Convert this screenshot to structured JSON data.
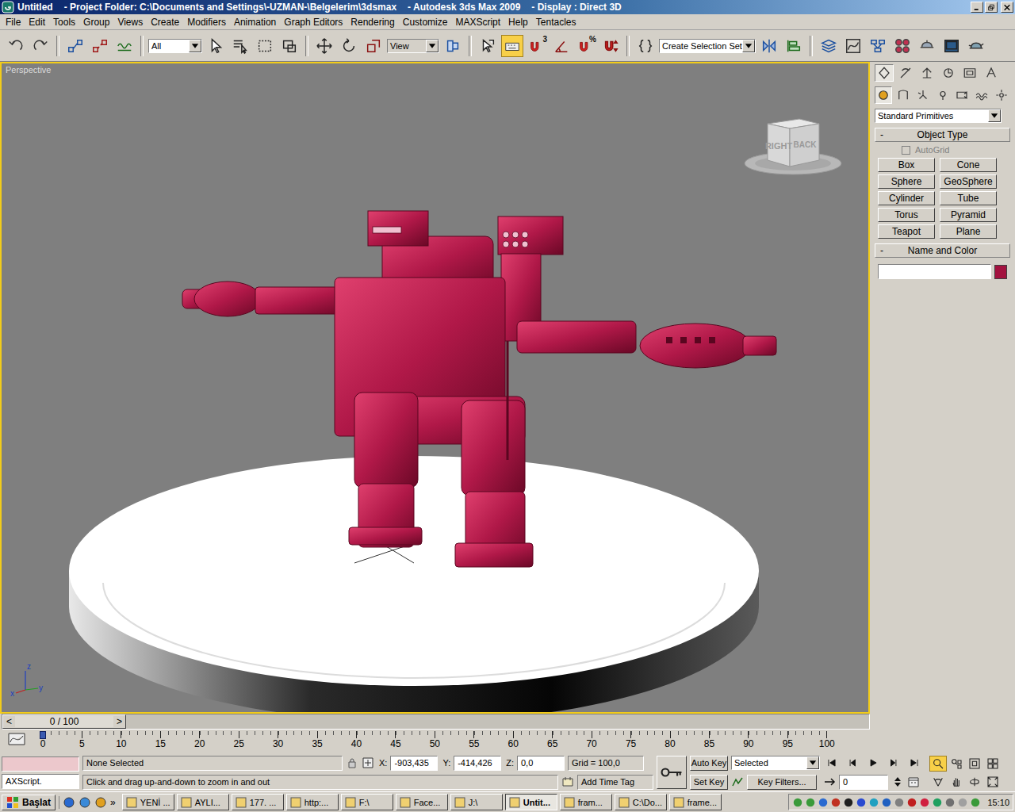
{
  "window": {
    "title": "Untitled",
    "project": "- Project Folder: C:\\Documents and Settings\\-UZMAN-\\Belgelerim\\3dsmax",
    "app": "- Autodesk 3ds Max  2009",
    "display": "- Display : Direct 3D"
  },
  "menu": [
    "File",
    "Edit",
    "Tools",
    "Group",
    "Views",
    "Create",
    "Modifiers",
    "Animation",
    "Graph Editors",
    "Rendering",
    "Customize",
    "MAXScript",
    "Help",
    "Tentacles"
  ],
  "toolbar": {
    "selection_filter": "All",
    "reference_coord": "View",
    "selection_set": "Create Selection Set",
    "snap_mode": "3",
    "percent_glyph": "%",
    "shortcut_override_on": true
  },
  "viewport": {
    "label": "Perspective",
    "viewcube": {
      "front": "RIGHT",
      "side": "BACK"
    },
    "axes": {
      "z": "z",
      "x": "x",
      "y": "y"
    }
  },
  "command_panel": {
    "tabs": [
      {
        "selected": true
      },
      {
        "selected": false
      },
      {
        "selected": false
      },
      {
        "selected": false
      },
      {
        "selected": false
      },
      {
        "selected": false
      }
    ],
    "categories": [
      {
        "selected": true
      },
      {
        "selected": false
      },
      {
        "selected": false
      },
      {
        "selected": false
      },
      {
        "selected": false
      },
      {
        "selected": false
      },
      {
        "selected": false
      }
    ],
    "category": "Standard Primitives",
    "object_type": {
      "collapse": "-",
      "title": "Object Type",
      "autogrid": {
        "label": "AutoGrid",
        "checked": false,
        "disabled": true
      },
      "buttons": [
        "Box",
        "Cone",
        "Sphere",
        "GeoSphere",
        "Cylinder",
        "Tube",
        "Torus",
        "Pyramid",
        "Teapot",
        "Plane"
      ]
    },
    "name_and_color": {
      "collapse": "-",
      "title": "Name and Color",
      "name": "",
      "color": "#a3123f"
    }
  },
  "time_slider": {
    "prev": "<",
    "label": "0 / 100",
    "next": ">",
    "level": 0
  },
  "track_bar": {
    "ticks": [
      "0",
      "5",
      "10",
      "15",
      "20",
      "25",
      "30",
      "35",
      "40",
      "45",
      "50",
      "55",
      "60",
      "65",
      "70",
      "75",
      "80",
      "85",
      "90",
      "95",
      "100"
    ]
  },
  "status": {
    "listener": "",
    "listener_output": "AXScript.",
    "selection": "None Selected",
    "x_label": "X:",
    "x": "-903,435",
    "y_label": "Y:",
    "y": "-414,426",
    "z_label": "Z:",
    "z": "0,0",
    "grid": "Grid = 100,0",
    "prompt": "Click and drag up-and-down to zoom in and out",
    "time_tag": "Add Time Tag"
  },
  "animation": {
    "auto_key": "Auto Key",
    "auto_key_on": false,
    "key_mode": "Selected",
    "set_key": "Set Key",
    "key_filters": "Key Filters...",
    "frame": "0"
  },
  "navigation": {
    "tools": [
      {
        "selected": true
      },
      {
        "selected": false
      },
      {
        "selected": false
      },
      {
        "selected": false
      },
      {
        "selected": false
      },
      {
        "selected": false
      },
      {
        "selected": false
      },
      {
        "selected": false
      }
    ]
  },
  "taskbar": {
    "start": "Başlat",
    "more": "»",
    "tasks": [
      {
        "label": "YENİ ...",
        "selected": false
      },
      {
        "label": "AYLI...",
        "selected": false
      },
      {
        "label": "177. ...",
        "selected": false
      },
      {
        "label": "http:...",
        "selected": false
      },
      {
        "label": "F:\\",
        "selected": false
      },
      {
        "label": "Face...",
        "selected": false
      },
      {
        "label": "J:\\",
        "selected": false
      },
      {
        "label": "Untit...",
        "selected": true
      },
      {
        "label": "fram...",
        "selected": false
      },
      {
        "label": "C:\\Do...",
        "selected": false
      },
      {
        "label": "frame...",
        "selected": false
      }
    ],
    "clock": "15:10"
  }
}
